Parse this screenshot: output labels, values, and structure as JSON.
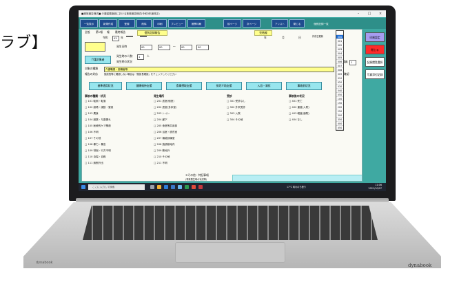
{
  "caption_label": "ラブ】",
  "laptop": {
    "brand_left": "dynabook",
    "brand_right": "dynabook"
  },
  "app": {
    "title": "■事故報告様式■ 介護保険施設における事故報告様式(令和3年度改正)",
    "toolbar_buttons": [
      "一覧表示",
      "新規作成",
      "登録",
      "削除",
      "印刷",
      "プレビュー",
      "帳票印刷",
      "前ページ",
      "次ページ",
      "アシスト",
      "閉じる",
      "個別記録一覧",
      "事故報告書作成ツール"
    ],
    "header": {
      "tab1": "全般",
      "tab2": "第1報",
      "tab3": "報",
      "tab4": "最終報告",
      "section": "個別記録報告",
      "status_badge": "完結報",
      "period_label": "令和",
      "year_value": "03",
      "year_unit": "年",
      "date_fields": [
        "年",
        "月",
        "日"
      ],
      "updated_label": "作成日更新",
      "report_reason_label": "記入"
    },
    "fields": {
      "facility_label": "介護対象者",
      "occurrence_label": "発生日時",
      "time_from": "00",
      "time_to": "00",
      "time_sep": "～",
      "persons_label": "発生時の人数：",
      "persons_value": "1",
      "persons_unit": "人",
      "staff_count_label": "職員",
      "staff_count_value": "1",
      "staff_unit": "人",
      "situation_label": "発生時の状況",
      "category_label": "対象の種類",
      "category_options": [
        "介護職員・役職者等",
        "主治医等・看護師等",
        "管理職員",
        "事務員",
        "その他"
      ],
      "policy_label": "報告の対応",
      "policy_text": "施設長等に確認しない場合は「施設長確認」をチェックしてください",
      "checkbox_done": "確認"
    },
    "dropdown_options": [
      "",
      "000",
      "001",
      "002",
      "003",
      "004",
      "005",
      "006",
      "007",
      "008",
      "009",
      "010",
      "020",
      "030",
      "040",
      "050",
      "100",
      "150",
      "200",
      "250",
      "300",
      "350",
      "400",
      "450"
    ],
    "dropdown_selected": "000",
    "action_buttons": [
      "基準適用状況",
      "健康維持支援",
      "食事摂取支援",
      "排泄介助支援",
      "入浴・清拭",
      "事故前状況"
    ],
    "columns": {
      "col1_title": "事故の種類・状況",
      "col1_items": [
        "101 転倒・転落",
        "102 誤嚥・誤飲・窒息",
        "103 異食",
        "104 誤薬・与薬漏れ",
        "105 医療的ケア関連",
        "106 不明",
        "107 その他",
        "108 暴力・暴言",
        "109 徘徊・行方不明",
        "110 自傷・自殺",
        "111 無断外出"
      ],
      "col2_title": "発生場所",
      "col2_items": [
        "201 居室(個室)",
        "202 居室(多床室)",
        "203 トイレ",
        "204 廊下",
        "205 食堂等共用部",
        "206 浴室・脱衣室",
        "207 機能訓練室",
        "208 施設敷地内",
        "209 敷地外",
        "210 その他",
        "211 不明"
      ],
      "col3_title": "受診",
      "col3_items": [
        "301 受診なし",
        "302 外来受診",
        "303 入院",
        "304 その他"
      ],
      "col4_title": "事故後の状況",
      "col4_items": [
        "401 死亡",
        "402 重度(入院)",
        "403 軽度(通院)",
        "404 なし"
      ]
    },
    "remarks_label": "⑤その他・特記事項",
    "remarks_sub": "(事故発生時の状況等)"
  },
  "side_buttons": [
    {
      "label": "印刷設定",
      "color": "#a79cf0"
    },
    {
      "label": "閉じる",
      "color": "#ff2a2a"
    },
    {
      "label": "記録閲覧選択",
      "color": "#ffffff"
    },
    {
      "label": "写真添付記録",
      "color": "#ffffff"
    }
  ],
  "taskbar": {
    "search_placeholder": "ここに入力して検索",
    "time": "11:06",
    "date": "2021/10/07",
    "weather": "17°C 晴れのち曇り"
  },
  "colors": {
    "screen_bg": "#3fa9a2",
    "toolbar_bg": "#2e8f89",
    "form_bg": "#fafaf4",
    "highlight": "#ffff8c"
  }
}
